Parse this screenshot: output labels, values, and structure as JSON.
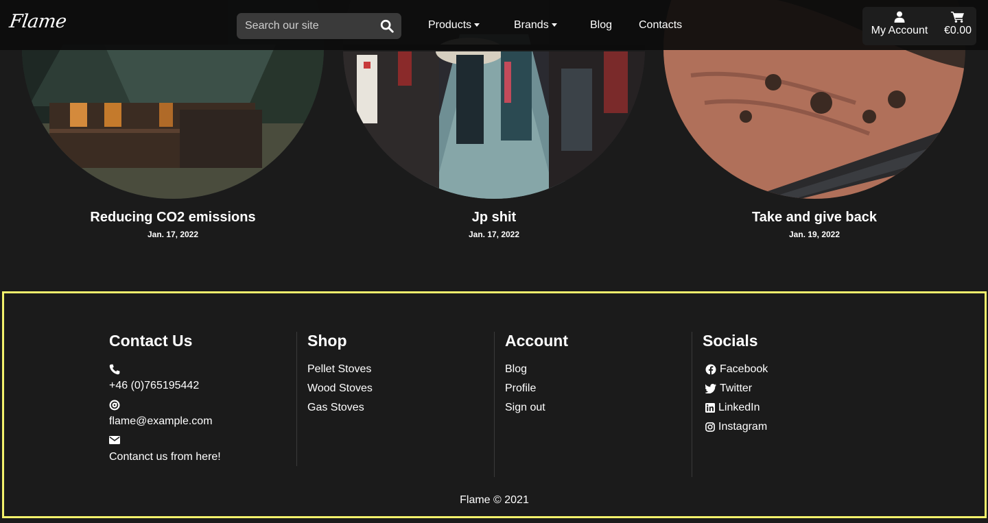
{
  "navbar": {
    "logo": "Flame",
    "search_placeholder": "Search our site",
    "links": {
      "products": "Products",
      "brands": "Brands",
      "blog": "Blog",
      "contacts": "Contacts"
    },
    "account_label": "My Account",
    "cart_total": "€0.00"
  },
  "posts": [
    {
      "title": "Reducing CO2 emissions",
      "date": "Jan. 17, 2022"
    },
    {
      "title": "Jp shit",
      "date": "Jan. 17, 2022"
    },
    {
      "title": "Take and give back",
      "date": "Jan. 19, 2022"
    }
  ],
  "footer": {
    "contact": {
      "heading": "Contact Us",
      "phone": "+46 (0)765195442",
      "email": "flame@example.com",
      "message": "Contanct us from here!"
    },
    "shop": {
      "heading": "Shop",
      "links": [
        "Pellet Stoves",
        "Wood Stoves",
        "Gas Stoves"
      ]
    },
    "account": {
      "heading": "Account",
      "links": [
        "Blog",
        "Profile",
        "Sign out"
      ]
    },
    "socials": {
      "heading": "Socials",
      "links": [
        "Facebook",
        "Twitter",
        "LinkedIn",
        "Instagram"
      ]
    },
    "copyright": "Flame © 2021"
  }
}
